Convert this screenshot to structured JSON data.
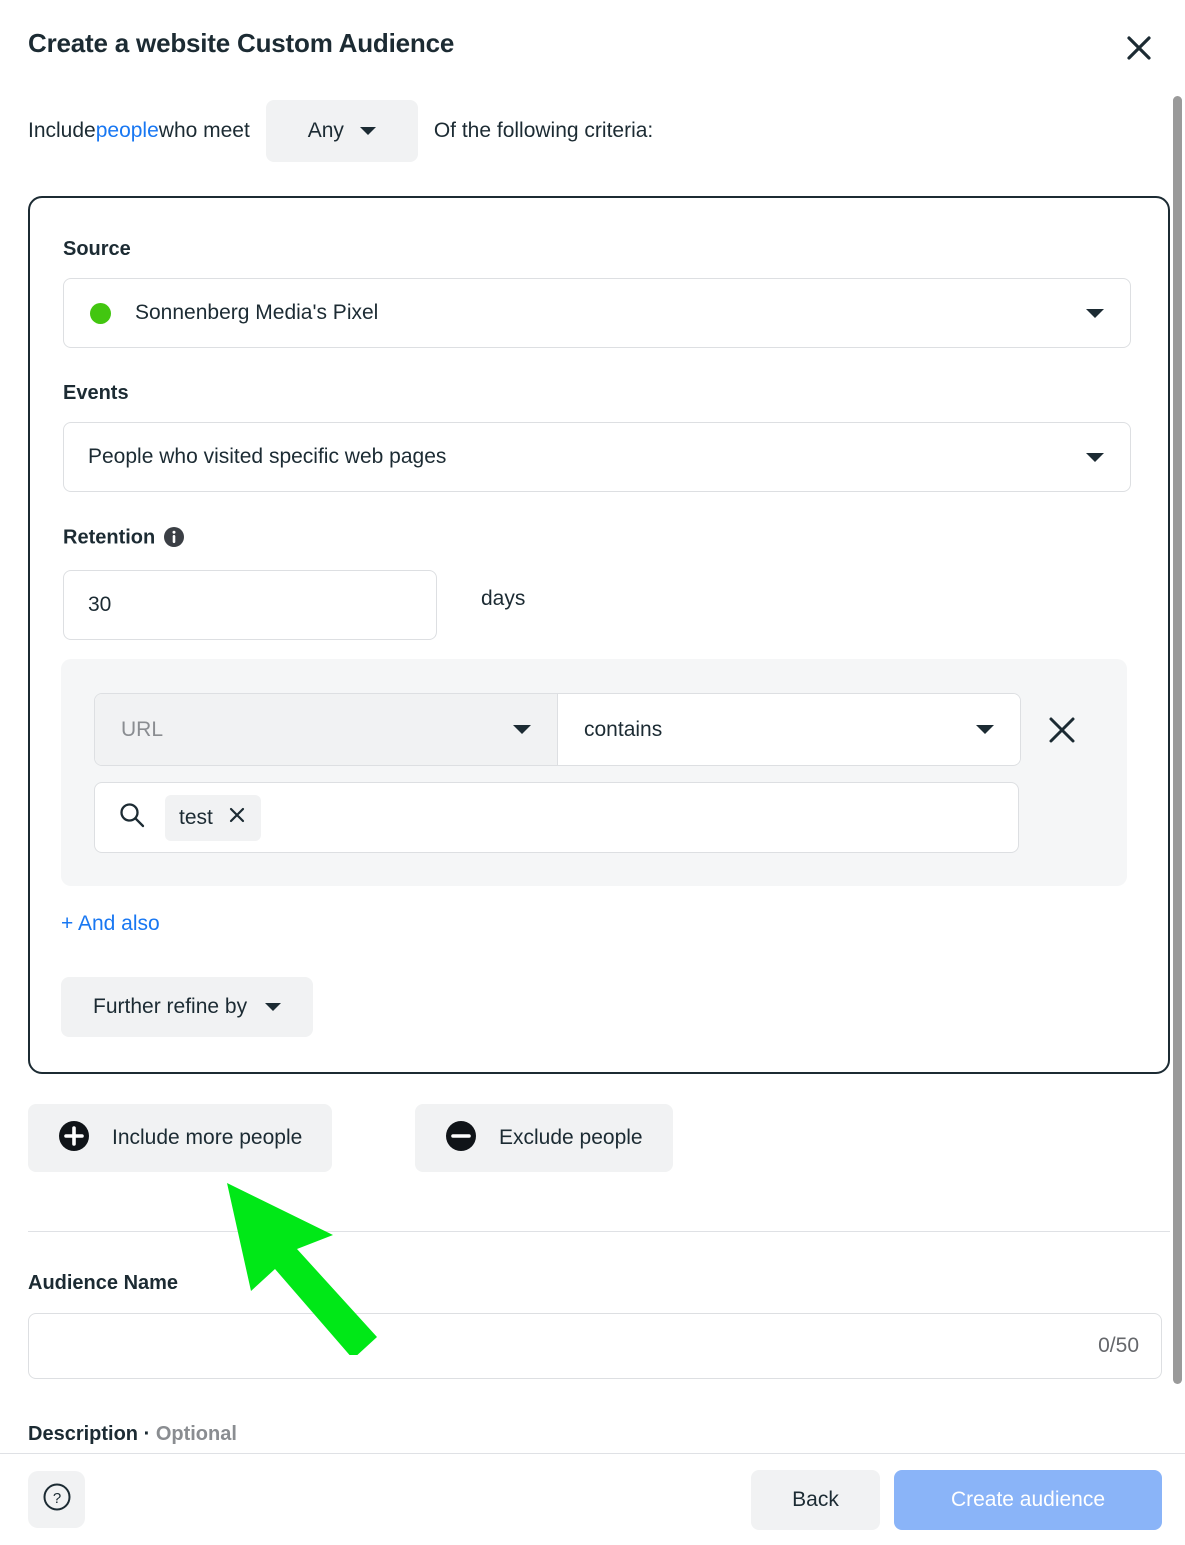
{
  "header": {
    "title": "Create a website Custom Audience",
    "close_icon": "close-icon"
  },
  "criteria_line": {
    "prefix": "Include ",
    "link": "people",
    "middle": " who meet",
    "match_selector_value": "Any",
    "suffix": "Of the following criteria:",
    "link_color": "#1877f2"
  },
  "card": {
    "source": {
      "label": "Source",
      "value": "Sonnenberg Media's Pixel",
      "status_color": "#42c610"
    },
    "events": {
      "label": "Events",
      "value": "People who visited specific web pages"
    },
    "retention": {
      "label": "Retention",
      "info_icon": "info-icon",
      "value": "30",
      "unit": "days"
    },
    "rule": {
      "field_placeholder": "URL",
      "operator": "contains",
      "remove_icon": "close-icon",
      "search_icon": "search-icon",
      "chips": [
        {
          "label": "test",
          "remove_icon": "close-icon"
        }
      ]
    },
    "and_also_label": "+ And also",
    "further_refine_label": "Further refine by"
  },
  "audience_scope": {
    "include_more_label": "Include more people",
    "include_icon": "plus-circle-icon",
    "exclude_label": "Exclude people",
    "exclude_icon": "minus-circle-icon"
  },
  "audience_name": {
    "label": "Audience Name",
    "value": "",
    "counter": "0/50"
  },
  "description": {
    "label": "Description",
    "separator": " · ",
    "optional": "Optional"
  },
  "footer": {
    "help_icon": "question-circle-icon",
    "back_label": "Back",
    "create_label": "Create audience",
    "create_color": "#8ab4f8"
  },
  "annotation": {
    "arrow_color": "#00e817",
    "points_to": "include-more-people-button"
  }
}
